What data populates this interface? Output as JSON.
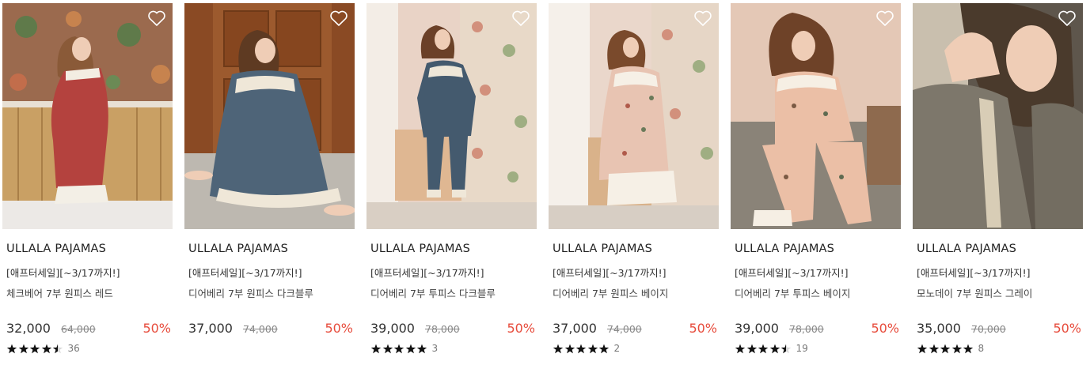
{
  "products": [
    {
      "brand": "ULLALA PAJAMAS",
      "promo": "[애프터세일][~3/17까지!]",
      "name": "체크베어 7부 원피스 레드",
      "price": "32,000",
      "original_price": "64,000",
      "discount": "50%",
      "rating": 4.5,
      "review_count": "36"
    },
    {
      "brand": "ULLALA PAJAMAS",
      "promo": "[애프터세일][~3/17까지!]",
      "name": "디어베리 7부 원피스 다크블루",
      "price": "37,000",
      "original_price": "74,000",
      "discount": "50%",
      "rating": null,
      "review_count": null
    },
    {
      "brand": "ULLALA PAJAMAS",
      "promo": "[애프터세일][~3/17까지!]",
      "name": "디어베리 7부 투피스 다크블루",
      "price": "39,000",
      "original_price": "78,000",
      "discount": "50%",
      "rating": 5,
      "review_count": "3"
    },
    {
      "brand": "ULLALA PAJAMAS",
      "promo": "[애프터세일][~3/17까지!]",
      "name": "디어베리 7부 원피스 베이지",
      "price": "37,000",
      "original_price": "74,000",
      "discount": "50%",
      "rating": 5,
      "review_count": "2"
    },
    {
      "brand": "ULLALA PAJAMAS",
      "promo": "[애프터세일][~3/17까지!]",
      "name": "디어베리 7부 투피스 베이지",
      "price": "39,000",
      "original_price": "78,000",
      "discount": "50%",
      "rating": 4.5,
      "review_count": "19"
    },
    {
      "brand": "ULLALA PAJAMAS",
      "promo": "[애프터세일][~3/17까지!]",
      "name": "모노데이 7부 원피스 그레이",
      "price": "35,000",
      "original_price": "70,000",
      "discount": "50%",
      "rating": 5,
      "review_count": "8"
    }
  ],
  "icons": {
    "wishlist": "heart-outline-icon",
    "rating": "star-icon"
  },
  "colors": {
    "discount": "#e74c3c",
    "price": "#333333",
    "strikethrough": "#888888",
    "star": "#111111"
  }
}
